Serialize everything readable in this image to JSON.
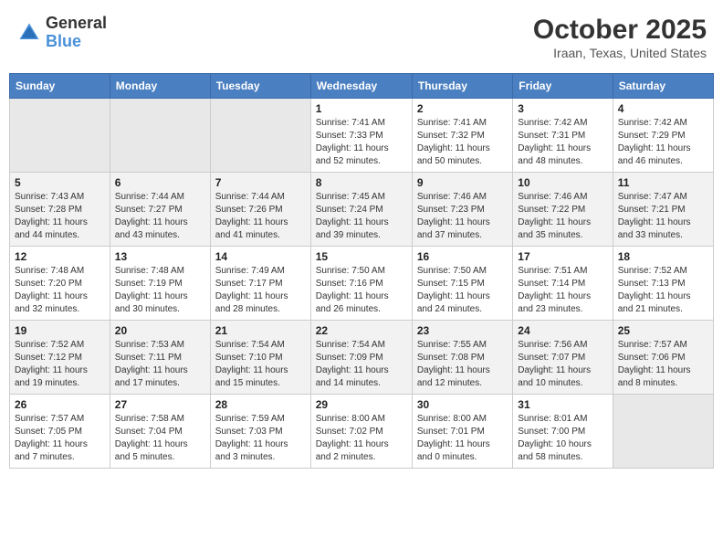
{
  "header": {
    "logo_general": "General",
    "logo_blue": "Blue",
    "month_title": "October 2025",
    "location": "Iraan, Texas, United States"
  },
  "weekdays": [
    "Sunday",
    "Monday",
    "Tuesday",
    "Wednesday",
    "Thursday",
    "Friday",
    "Saturday"
  ],
  "weeks": [
    [
      {
        "day": "",
        "info": ""
      },
      {
        "day": "",
        "info": ""
      },
      {
        "day": "",
        "info": ""
      },
      {
        "day": "1",
        "info": "Sunrise: 7:41 AM\nSunset: 7:33 PM\nDaylight: 11 hours\nand 52 minutes."
      },
      {
        "day": "2",
        "info": "Sunrise: 7:41 AM\nSunset: 7:32 PM\nDaylight: 11 hours\nand 50 minutes."
      },
      {
        "day": "3",
        "info": "Sunrise: 7:42 AM\nSunset: 7:31 PM\nDaylight: 11 hours\nand 48 minutes."
      },
      {
        "day": "4",
        "info": "Sunrise: 7:42 AM\nSunset: 7:29 PM\nDaylight: 11 hours\nand 46 minutes."
      }
    ],
    [
      {
        "day": "5",
        "info": "Sunrise: 7:43 AM\nSunset: 7:28 PM\nDaylight: 11 hours\nand 44 minutes."
      },
      {
        "day": "6",
        "info": "Sunrise: 7:44 AM\nSunset: 7:27 PM\nDaylight: 11 hours\nand 43 minutes."
      },
      {
        "day": "7",
        "info": "Sunrise: 7:44 AM\nSunset: 7:26 PM\nDaylight: 11 hours\nand 41 minutes."
      },
      {
        "day": "8",
        "info": "Sunrise: 7:45 AM\nSunset: 7:24 PM\nDaylight: 11 hours\nand 39 minutes."
      },
      {
        "day": "9",
        "info": "Sunrise: 7:46 AM\nSunset: 7:23 PM\nDaylight: 11 hours\nand 37 minutes."
      },
      {
        "day": "10",
        "info": "Sunrise: 7:46 AM\nSunset: 7:22 PM\nDaylight: 11 hours\nand 35 minutes."
      },
      {
        "day": "11",
        "info": "Sunrise: 7:47 AM\nSunset: 7:21 PM\nDaylight: 11 hours\nand 33 minutes."
      }
    ],
    [
      {
        "day": "12",
        "info": "Sunrise: 7:48 AM\nSunset: 7:20 PM\nDaylight: 11 hours\nand 32 minutes."
      },
      {
        "day": "13",
        "info": "Sunrise: 7:48 AM\nSunset: 7:19 PM\nDaylight: 11 hours\nand 30 minutes."
      },
      {
        "day": "14",
        "info": "Sunrise: 7:49 AM\nSunset: 7:17 PM\nDaylight: 11 hours\nand 28 minutes."
      },
      {
        "day": "15",
        "info": "Sunrise: 7:50 AM\nSunset: 7:16 PM\nDaylight: 11 hours\nand 26 minutes."
      },
      {
        "day": "16",
        "info": "Sunrise: 7:50 AM\nSunset: 7:15 PM\nDaylight: 11 hours\nand 24 minutes."
      },
      {
        "day": "17",
        "info": "Sunrise: 7:51 AM\nSunset: 7:14 PM\nDaylight: 11 hours\nand 23 minutes."
      },
      {
        "day": "18",
        "info": "Sunrise: 7:52 AM\nSunset: 7:13 PM\nDaylight: 11 hours\nand 21 minutes."
      }
    ],
    [
      {
        "day": "19",
        "info": "Sunrise: 7:52 AM\nSunset: 7:12 PM\nDaylight: 11 hours\nand 19 minutes."
      },
      {
        "day": "20",
        "info": "Sunrise: 7:53 AM\nSunset: 7:11 PM\nDaylight: 11 hours\nand 17 minutes."
      },
      {
        "day": "21",
        "info": "Sunrise: 7:54 AM\nSunset: 7:10 PM\nDaylight: 11 hours\nand 15 minutes."
      },
      {
        "day": "22",
        "info": "Sunrise: 7:54 AM\nSunset: 7:09 PM\nDaylight: 11 hours\nand 14 minutes."
      },
      {
        "day": "23",
        "info": "Sunrise: 7:55 AM\nSunset: 7:08 PM\nDaylight: 11 hours\nand 12 minutes."
      },
      {
        "day": "24",
        "info": "Sunrise: 7:56 AM\nSunset: 7:07 PM\nDaylight: 11 hours\nand 10 minutes."
      },
      {
        "day": "25",
        "info": "Sunrise: 7:57 AM\nSunset: 7:06 PM\nDaylight: 11 hours\nand 8 minutes."
      }
    ],
    [
      {
        "day": "26",
        "info": "Sunrise: 7:57 AM\nSunset: 7:05 PM\nDaylight: 11 hours\nand 7 minutes."
      },
      {
        "day": "27",
        "info": "Sunrise: 7:58 AM\nSunset: 7:04 PM\nDaylight: 11 hours\nand 5 minutes."
      },
      {
        "day": "28",
        "info": "Sunrise: 7:59 AM\nSunset: 7:03 PM\nDaylight: 11 hours\nand 3 minutes."
      },
      {
        "day": "29",
        "info": "Sunrise: 8:00 AM\nSunset: 7:02 PM\nDaylight: 11 hours\nand 2 minutes."
      },
      {
        "day": "30",
        "info": "Sunrise: 8:00 AM\nSunset: 7:01 PM\nDaylight: 11 hours\nand 0 minutes."
      },
      {
        "day": "31",
        "info": "Sunrise: 8:01 AM\nSunset: 7:00 PM\nDaylight: 10 hours\nand 58 minutes."
      },
      {
        "day": "",
        "info": ""
      }
    ]
  ]
}
